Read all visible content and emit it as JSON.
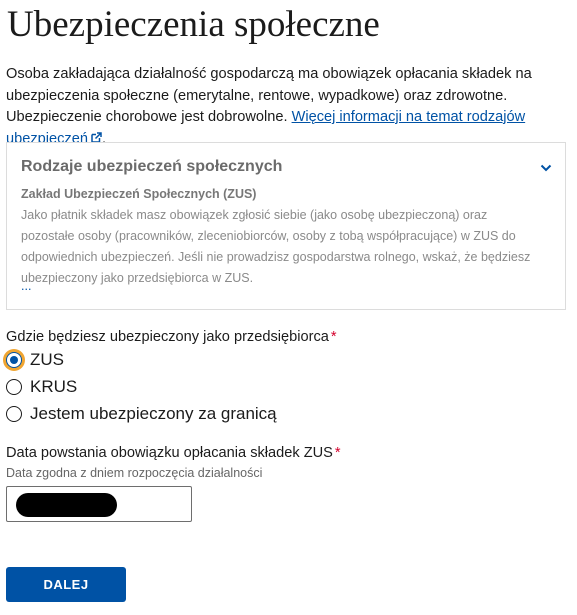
{
  "page_title": "Ubezpieczenia społeczne",
  "intro": {
    "text": "Osoba zakładająca działalność gospodarczą ma obowiązek opłacania składek na ubezpieczenia społeczne (emerytalne, rentowe, wypadkowe) oraz zdrowotne. Ubezpieczenie chorobowe jest dobrowolne. ",
    "link": "Więcej informacji na temat rodzajów ubezpieczeń",
    "after_link": "."
  },
  "accordion": {
    "title": "Rodzaje ubezpieczeń społecznych",
    "subtitle": "Zakład Ubezpieczeń Społecznych (ZUS)",
    "body": "Jako płatnik składek masz obowiązek zgłosić siebie (jako osobę ubezpieczoną) oraz pozostałe osoby (pracowników, zleceniobiorców, osoby z tobą współpracujące) w ZUS do odpowiednich ubezpieczeń. Jeśli nie prowadzisz gospodarstwa rolnego, wskaż, że będziesz ubezpieczony jako przedsiębiorca w ZUS.",
    "more": "..."
  },
  "insurance_question": {
    "label": "Gdzie będziesz ubezpieczony jako przedsiębiorca",
    "required_mark": "*",
    "options": [
      {
        "label": "ZUS",
        "selected": true
      },
      {
        "label": "KRUS",
        "selected": false
      },
      {
        "label": "Jestem ubezpieczony za granicą",
        "selected": false
      }
    ]
  },
  "date_field": {
    "label": "Data powstania obowiązku opłacania składek ZUS",
    "required_mark": "*",
    "hint": "Data zgodna z dniem rozpoczęcia działalności"
  },
  "next_button": "DALEJ",
  "colors": {
    "primary": "#0052a5",
    "focus_ring": "#f0a531",
    "required": "#d4002c"
  }
}
